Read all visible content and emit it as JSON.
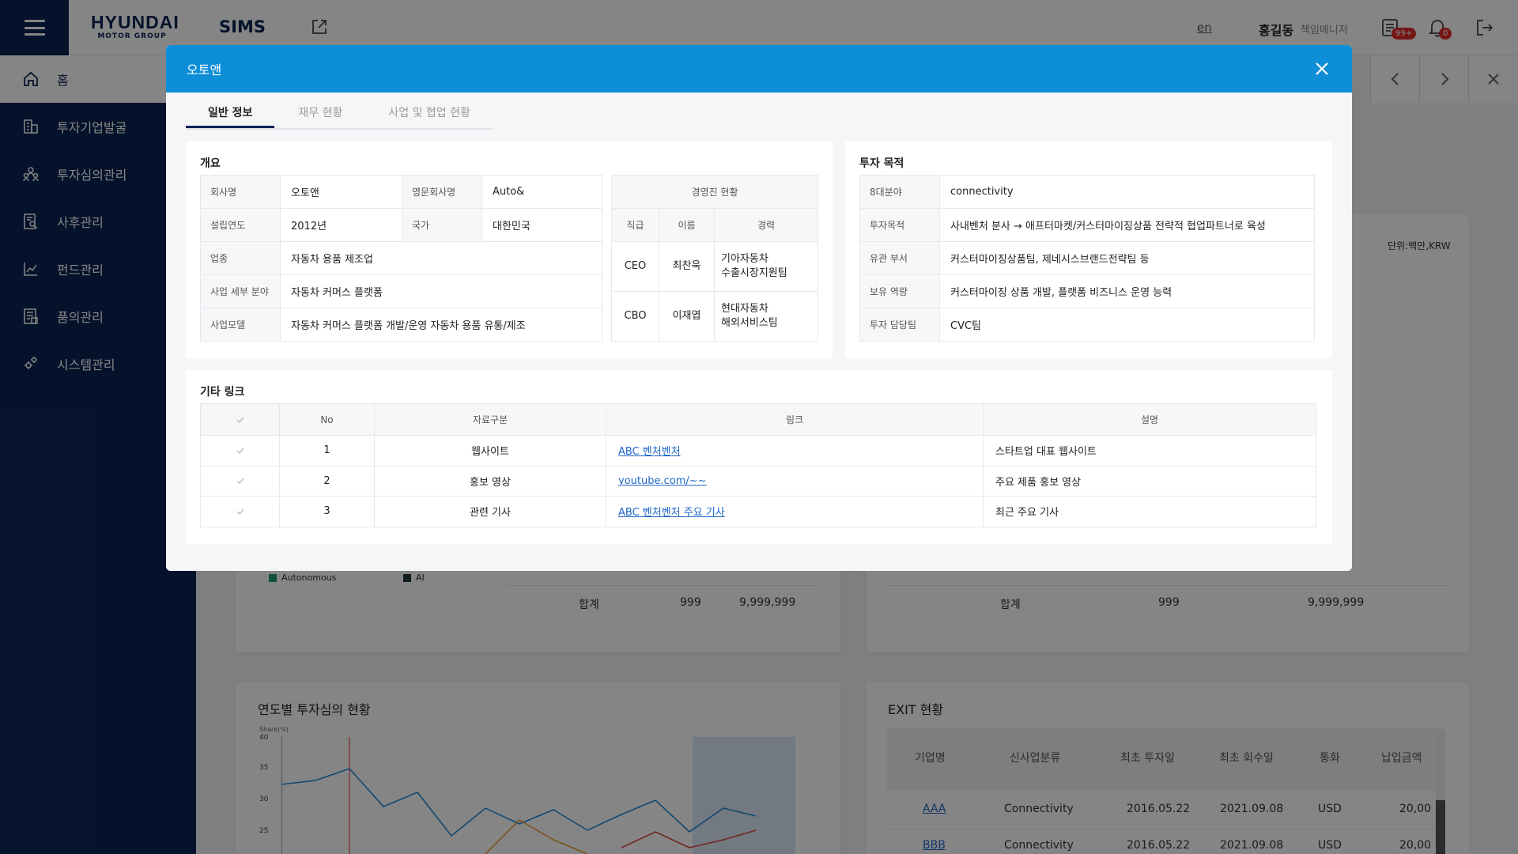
{
  "header": {
    "logo_line1": "HYUNDAI",
    "logo_line2": "MOTOR GROUP",
    "app_name": "SIMS",
    "lang": "en",
    "user_name": "홍길동",
    "user_role": "책임매니저",
    "message_badge": "99+",
    "alert_badge": "0"
  },
  "sidebar": {
    "home": "홈",
    "items": [
      {
        "label": "투자기업발굴",
        "icon": "building-icon"
      },
      {
        "label": "투자심의관리",
        "icon": "people-icon"
      },
      {
        "label": "사후관리",
        "icon": "document-search-icon"
      },
      {
        "label": "펀드관리",
        "icon": "chart-icon"
      },
      {
        "label": "품의관리",
        "icon": "approval-doc-icon"
      },
      {
        "label": "시스템관리",
        "icon": "gear-icon"
      }
    ]
  },
  "background": {
    "unit_label": "단위:백만,KRW",
    "legend_autonomous": "Autonomous",
    "legend_ai": "AI",
    "sum_label_left": "합계",
    "sum_count_left": "999",
    "sum_amount_left": "9,999,999",
    "sum_label_right": "합계",
    "sum_count_right": "999",
    "sum_amount_right": "9,999,999",
    "yearly_chart_title": "연도별 투자심의 현황",
    "yearly_chart_ylabel": "Share(%)",
    "yearly_chart_ticks": [
      "40",
      "35",
      "30",
      "25"
    ],
    "exit_title": "EXIT 현황",
    "exit_columns": [
      "기업명",
      "신사업분류",
      "최초 투자일",
      "최초 회수일",
      "통화",
      "납입금액"
    ],
    "exit_rows": [
      {
        "name": "AAA",
        "category": "Connectivity",
        "invest_date": "2016.05.22",
        "return_date": "2021.09.08",
        "currency": "USD",
        "amount": "20,00"
      },
      {
        "name": "BBB",
        "category": "Connectivity",
        "invest_date": "2016.05.22",
        "return_date": "2021.09.08",
        "currency": "USD",
        "amount": "20,00"
      }
    ]
  },
  "modal": {
    "title": "오토앤",
    "tabs": [
      {
        "label": "일반 정보",
        "active": true
      },
      {
        "label": "재무 현황",
        "active": false
      },
      {
        "label": "사업 및 협업 현황",
        "active": false
      }
    ],
    "overview": {
      "title": "개요",
      "company_label": "회사명",
      "company": "오토앤",
      "eng_label": "영문회사명",
      "eng": "Auto&",
      "founded_label": "설립연도",
      "founded": "2012년",
      "country_label": "국가",
      "country": "대한민국",
      "industry_label": "업종",
      "industry": "자동차 용품 제조업",
      "field_label": "사업 세부 분야",
      "field": "자동차 커머스 플랫폼",
      "model_label": "사업모델",
      "model": "자동차 커머스 플랫폼 개발/운영 자동차 용품 유통/제조"
    },
    "executives": {
      "title": "경영진 현황",
      "col_position": "직급",
      "col_name": "이름",
      "col_career": "경력",
      "rows": [
        {
          "position": "CEO",
          "name": "최찬욱",
          "career1": "기아자동차",
          "career2": "수출시장지원팀"
        },
        {
          "position": "CBO",
          "name": "이재엽",
          "career1": "현대자동차",
          "career2": "해외서비스팀"
        }
      ]
    },
    "purpose": {
      "title": "투자 목적",
      "rows": [
        {
          "label": "8대분야",
          "value": "connectivity"
        },
        {
          "label": "투자목적",
          "value": "사내벤처 분사 → 애프터마켓/커스터마이징상품 전략적 협업파트너로 육성"
        },
        {
          "label": "유관 부서",
          "value": "커스터마이징상품팀, 제네시스브랜드전략팀 등"
        },
        {
          "label": "보유 역량",
          "value": "커스터마이징 상품 개발, 플랫폼 비즈니스 운영 능력"
        },
        {
          "label": "투자 담당팀",
          "value": "CVC팀"
        }
      ]
    },
    "links": {
      "title": "기타 링크",
      "col_no": "No",
      "col_type": "자료구분",
      "col_link": "링크",
      "col_desc": "설명",
      "rows": [
        {
          "no": "1",
          "type": "웹사이트",
          "link": "ABC 벤처벤처",
          "desc": "스타트업 대표 웹사이트"
        },
        {
          "no": "2",
          "type": "홍보 영상",
          "link": "youtube.com/~~",
          "desc": "주요 제품 홍보 영상"
        },
        {
          "no": "3",
          "type": "관련 기사",
          "link": "ABC 벤처벤처 주요 기사",
          "desc": "최근 주요 기사"
        }
      ]
    }
  }
}
